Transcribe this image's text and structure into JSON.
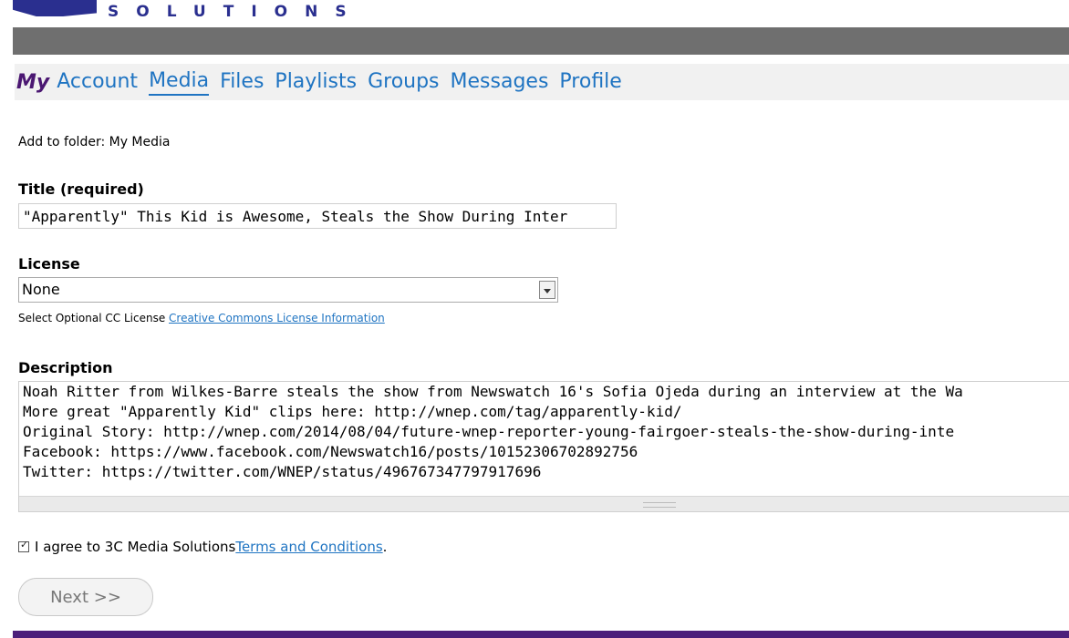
{
  "brand": {
    "logo_text": "SOLUTIONS"
  },
  "nav": {
    "my": "My",
    "items": [
      {
        "label": "Account"
      },
      {
        "label": "Media",
        "active": true
      },
      {
        "label": "Files"
      },
      {
        "label": "Playlists"
      },
      {
        "label": "Groups"
      },
      {
        "label": "Messages"
      },
      {
        "label": "Profile"
      }
    ]
  },
  "form": {
    "folder_label": "Add to folder: My Media",
    "title_label": "Title (required)",
    "title_value": "\"Apparently\" This Kid is Awesome, Steals the Show During Inter",
    "license_label": "License",
    "license_value": "None",
    "license_help_text": "Select Optional CC License ",
    "license_help_link": "Creative Commons License Information",
    "description_label": "Description",
    "description_lines": [
      "Noah Ritter from Wilkes-Barre steals the show from Newswatch 16's Sofia Ojeda during an interview at the Wa",
      "More great \"Apparently Kid\" clips here: http://wnep.com/tag/apparently-kid/",
      "Original Story: http://wnep.com/2014/08/04/future-wnep-reporter-young-fairgoer-steals-the-show-during-inte",
      "Facebook: https://www.facebook.com/Newswatch16/posts/10152306702892756",
      "Twitter: https://twitter.com/WNEP/status/496767347797917696"
    ],
    "agree_text": "I agree to 3C Media Solutions ",
    "agree_link": "Terms and Conditions",
    "agree_period": ".",
    "agree_checked": true,
    "next_label": "Next >>"
  },
  "colors": {
    "nav_link": "#1f74c2",
    "brand_purple": "#4b1772",
    "top_bar": "#6f6f6f",
    "footer_bar": "#4c1f7a"
  }
}
